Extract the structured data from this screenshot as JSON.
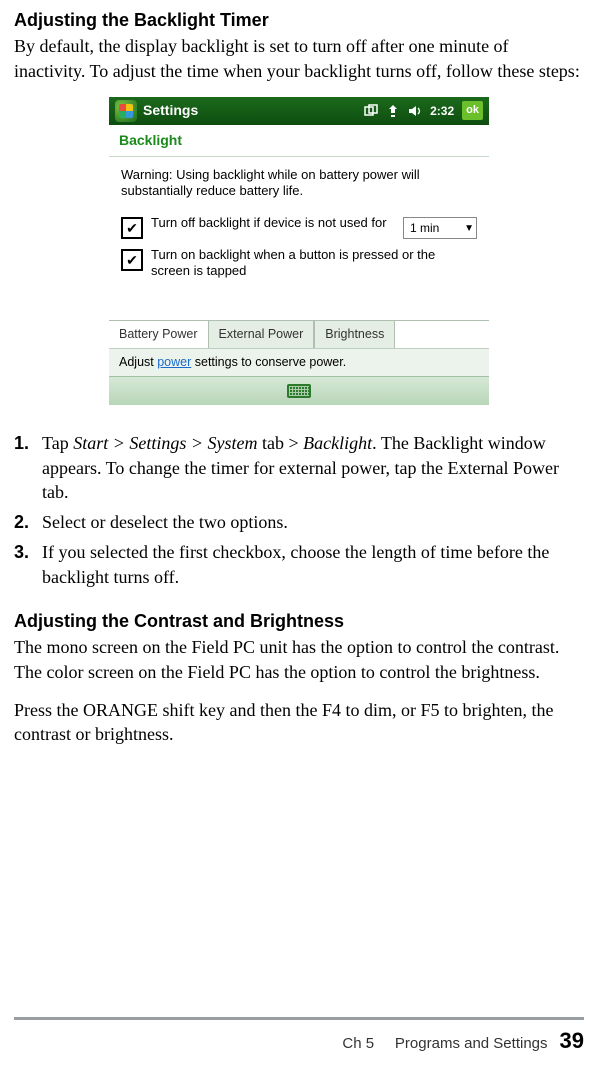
{
  "section1": {
    "heading": "Adjusting the Backlight Timer",
    "intro": "By default, the display backlight is set to turn off after one minute of inactivity. To adjust the time when your backlight turns off, follow these steps:"
  },
  "device": {
    "titlebar": {
      "title": "Settings",
      "time": "2:32",
      "ok": "ok"
    },
    "subheader": "Backlight",
    "warning": "Warning: Using backlight while on battery power will substantially reduce battery life.",
    "option1": "Turn off backlight if device is not used for",
    "option2": "Turn on backlight when a button is pressed or the screen is tapped",
    "duration": "1 min",
    "tabs": {
      "t1": "Battery Power",
      "t2": "External Power",
      "t3": "Brightness"
    },
    "hint_pre": "Adjust ",
    "hint_link": "power",
    "hint_post": " settings to conserve power."
  },
  "steps": {
    "s1_num": "1.",
    "s1_a": "Tap ",
    "s1_b": "Start > Settings > System",
    "s1_c": " tab > ",
    "s1_d": "Backlight",
    "s1_e": ". The Backlight window appears. To change the timer for external power, tap the External Power tab.",
    "s2_num": "2.",
    "s2": "Select or deselect the two options.",
    "s3_num": "3.",
    "s3": "If you selected the first checkbox, choose the length of time before the backlight turns off."
  },
  "section2": {
    "heading": "Adjusting the Contrast and Brightness",
    "p1": "The mono screen on the Field PC unit has the option to control the contrast. The color screen on the Field PC has the option to control the brightness.",
    "p2": "Press the ORANGE shift key and then the F4 to dim, or F5 to brighten, the contrast or brightness."
  },
  "footer": {
    "chapter": "Ch 5     Programs and Settings",
    "page": "39"
  }
}
